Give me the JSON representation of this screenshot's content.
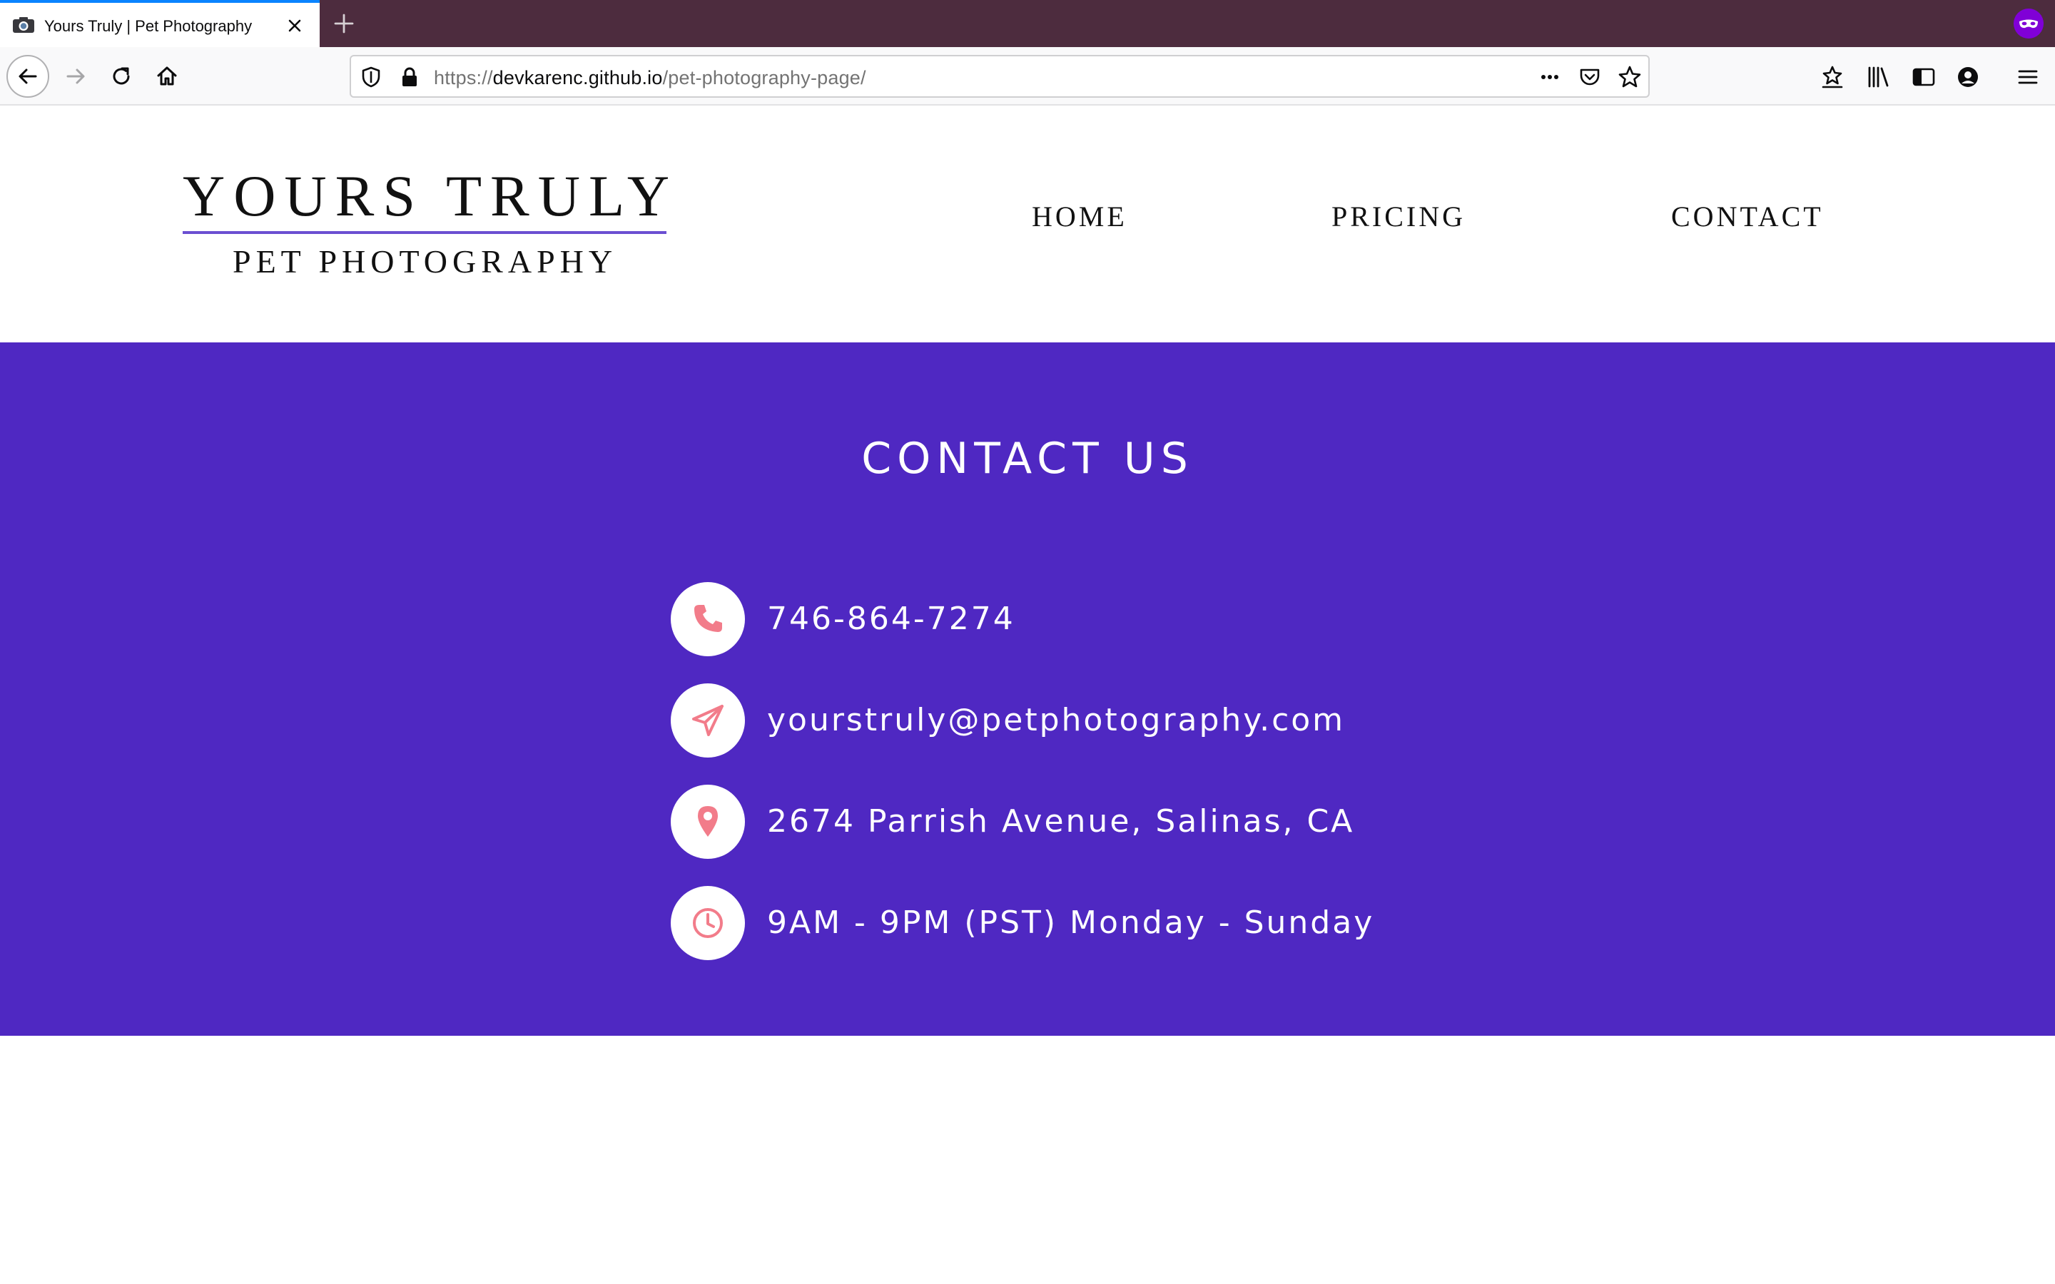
{
  "browser": {
    "tab_title": "Yours Truly | Pet Photography",
    "url_scheme": "https://",
    "url_host": "devkarenc.github.io",
    "url_path": "/pet-photography-page/",
    "tab_accent_color": "#0a84ff",
    "tabstrip_color": "#4d2c3e"
  },
  "site": {
    "logo_title": "YOURS TRULY",
    "logo_subtitle": "PET PHOTOGRAPHY",
    "nav": {
      "home": "HOME",
      "pricing": "PRICING",
      "contact": "CONTACT"
    }
  },
  "contact": {
    "heading": "CONTACT US",
    "background_color": "#4f28c2",
    "icon_color": "#f27c8a",
    "items": [
      {
        "icon": "phone-icon",
        "text": "746-864-7274"
      },
      {
        "icon": "paper-plane-icon",
        "text": "yourstruly@petphotography.com"
      },
      {
        "icon": "map-pin-icon",
        "text": "2674 Parrish Avenue, Salinas, CA"
      },
      {
        "icon": "clock-icon",
        "text": "9AM - 9PM (PST) Monday - Sunday"
      }
    ]
  }
}
